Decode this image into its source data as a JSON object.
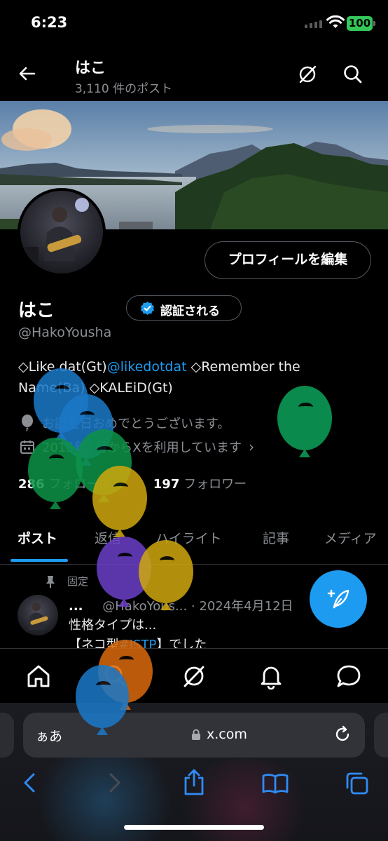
{
  "status_bar": {
    "time": "6:23",
    "battery": "100"
  },
  "header": {
    "title": "はこ",
    "subtitle": "3,110 件のポスト"
  },
  "profile": {
    "edit_button": "プロフィールを編集",
    "name": "はこ",
    "verify_button": "認証される",
    "handle": "@HakoYousha",
    "bio_part1": "◇Like.dat(Gt)",
    "bio_mention": "@likedotdat",
    "bio_part2": " ◇Remember the Name(Ba) ◇KALEiD(Gt)",
    "birthday_text": "お誕生日おめでとうございます。",
    "joined_text": "2015年3月からXを利用しています",
    "following_count": "286",
    "following_label": "フォロー中",
    "followers_count": "197",
    "followers_label": "フォロワー"
  },
  "tabs": [
    {
      "label": "ポスト"
    },
    {
      "label": "返信"
    },
    {
      "label": "ハイライト"
    },
    {
      "label": "記事"
    },
    {
      "label": "メディア"
    }
  ],
  "pinned_post": {
    "pinned_label": "固定",
    "dots": "...",
    "handle": "@HakoYous...",
    "date": "· 2024年4月12日",
    "line1": "性格タイプは...",
    "line2_prefix": "【ネコ型",
    "line2_tag": "#ISTP",
    "line2_suffix": "】でした"
  },
  "safari": {
    "text_size": "ぁあ",
    "url": "x.com"
  },
  "icons": {
    "back": "back-arrow-icon",
    "grok_header": "grok-icon",
    "search": "search-icon",
    "verified": "verified-badge-icon",
    "birthday": "balloon-icon",
    "calendar": "calendar-icon",
    "pin": "pin-icon",
    "compose": "compose-icon",
    "home": "home-icon",
    "grok": "grok-icon",
    "notifications": "bell-icon",
    "messages": "message-icon"
  },
  "colors": {
    "accent": "#1d9bf0",
    "background": "#000000",
    "muted": "#8b8f94",
    "battery": "#34c759"
  }
}
